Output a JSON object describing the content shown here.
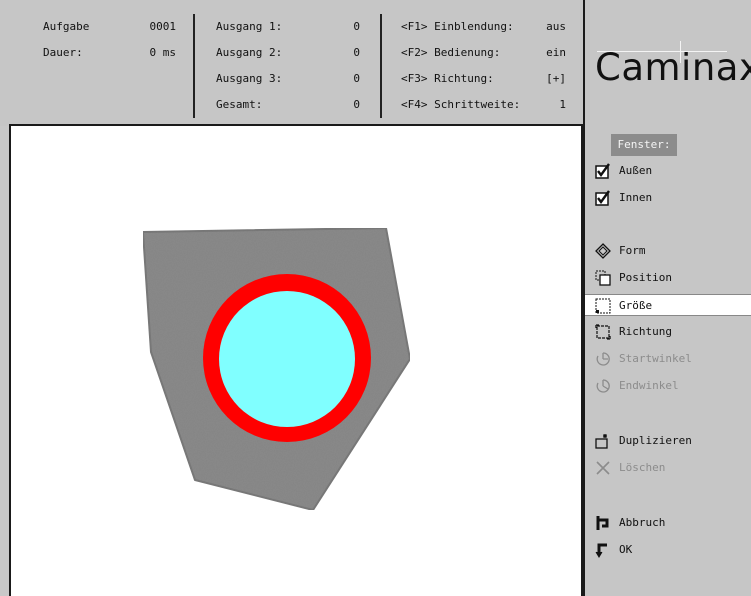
{
  "header": {
    "aufgabe_label": "Aufgabe",
    "aufgabe_value": "0001",
    "dauer_label": "Dauer:",
    "dauer_value": "0 ms",
    "ausgang1_label": "Ausgang 1:",
    "ausgang1_value": "0",
    "ausgang2_label": "Ausgang 2:",
    "ausgang2_value": "0",
    "ausgang3_label": "Ausgang 3:",
    "ausgang3_value": "0",
    "gesamt_label": "Gesamt:",
    "gesamt_value": "0",
    "f1_label": "<F1> Einblendung:",
    "f1_value": "aus",
    "f2_label": "<F2> Bedienung:",
    "f2_value": "ein",
    "f3_label": "<F3> Richtung:",
    "f3_value": "[+]",
    "f4_label": "<F4> Schrittweite:",
    "f4_value": "1"
  },
  "logo": {
    "text": "Caminax"
  },
  "side": {
    "fenster_label": "Fenster:",
    "aussen_label": "Außen",
    "innen_label": "Innen",
    "form_label": "Form",
    "position_label": "Position",
    "groesse_label": "Größe",
    "richtung_label": "Richtung",
    "startwinkel_label": "Startwinkel",
    "endwinkel_label": "Endwinkel",
    "duplizieren_label": "Duplizieren",
    "loeschen_label": "Löschen",
    "abbruch_label": "Abbruch",
    "ok_label": "OK"
  },
  "colors": {
    "ring": "#ff0000",
    "inner_fill": "#80ffff",
    "part": "#8a8a8a",
    "panel": "#c6c6c6",
    "disabled_text": "#8c8c8c"
  },
  "checkboxes": {
    "aussen_checked": true,
    "innen_checked": true
  },
  "selected_tool": "Größe"
}
